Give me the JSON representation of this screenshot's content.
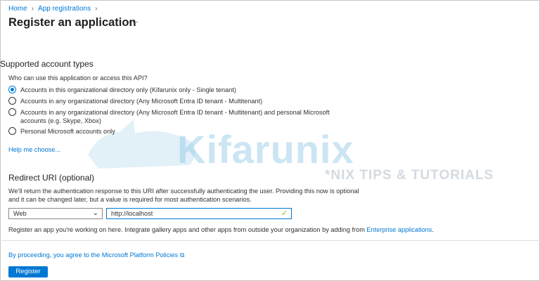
{
  "breadcrumb": {
    "items": [
      "Home",
      "App registrations"
    ]
  },
  "page": {
    "title": "Register an application",
    "more_label": "···"
  },
  "account_types": {
    "heading": "Supported account types",
    "question": "Who can use this application or access this API?",
    "options": [
      {
        "label": "Accounts in this organizational directory only (Kifarunix only - Single tenant)",
        "selected": true
      },
      {
        "label": "Accounts in any organizational directory (Any Microsoft Entra ID tenant - Multitenant)",
        "selected": false
      },
      {
        "label": "Accounts in any organizational directory (Any Microsoft Entra ID tenant - Multitenant) and personal Microsoft accounts (e.g. Skype, Xbox)",
        "selected": false
      },
      {
        "label": "Personal Microsoft accounts only",
        "selected": false
      }
    ],
    "help_link": "Help me choose..."
  },
  "redirect": {
    "heading": "Redirect URI (optional)",
    "description": "We'll return the authentication response to this URI after successfully authenticating the user. Providing this now is optional and it can be changed later, but a value is required for most authentication scenarios.",
    "platform_value": "Web",
    "uri_value": "http://localhost",
    "note_prefix": "Register an app you're working on here. Integrate gallery apps and other apps from outside your organization by adding from ",
    "note_link": "Enterprise applications",
    "note_suffix": "."
  },
  "footer": {
    "policy_link": "By proceeding, you agree to the Microsoft Platform Policies",
    "register_label": "Register"
  },
  "watermark": {
    "logo": "Kifarunix",
    "tagline": "*NIX TIPS & TUTORIALS"
  },
  "colors": {
    "accent": "#0078d4",
    "valid_check": "#8cbd18"
  },
  "icons": {
    "breadcrumb_separator": "chevron-right-icon",
    "select": "chevron-down-icon",
    "uri_valid": "checkmark-icon",
    "policy_link": "external-link-icon"
  }
}
